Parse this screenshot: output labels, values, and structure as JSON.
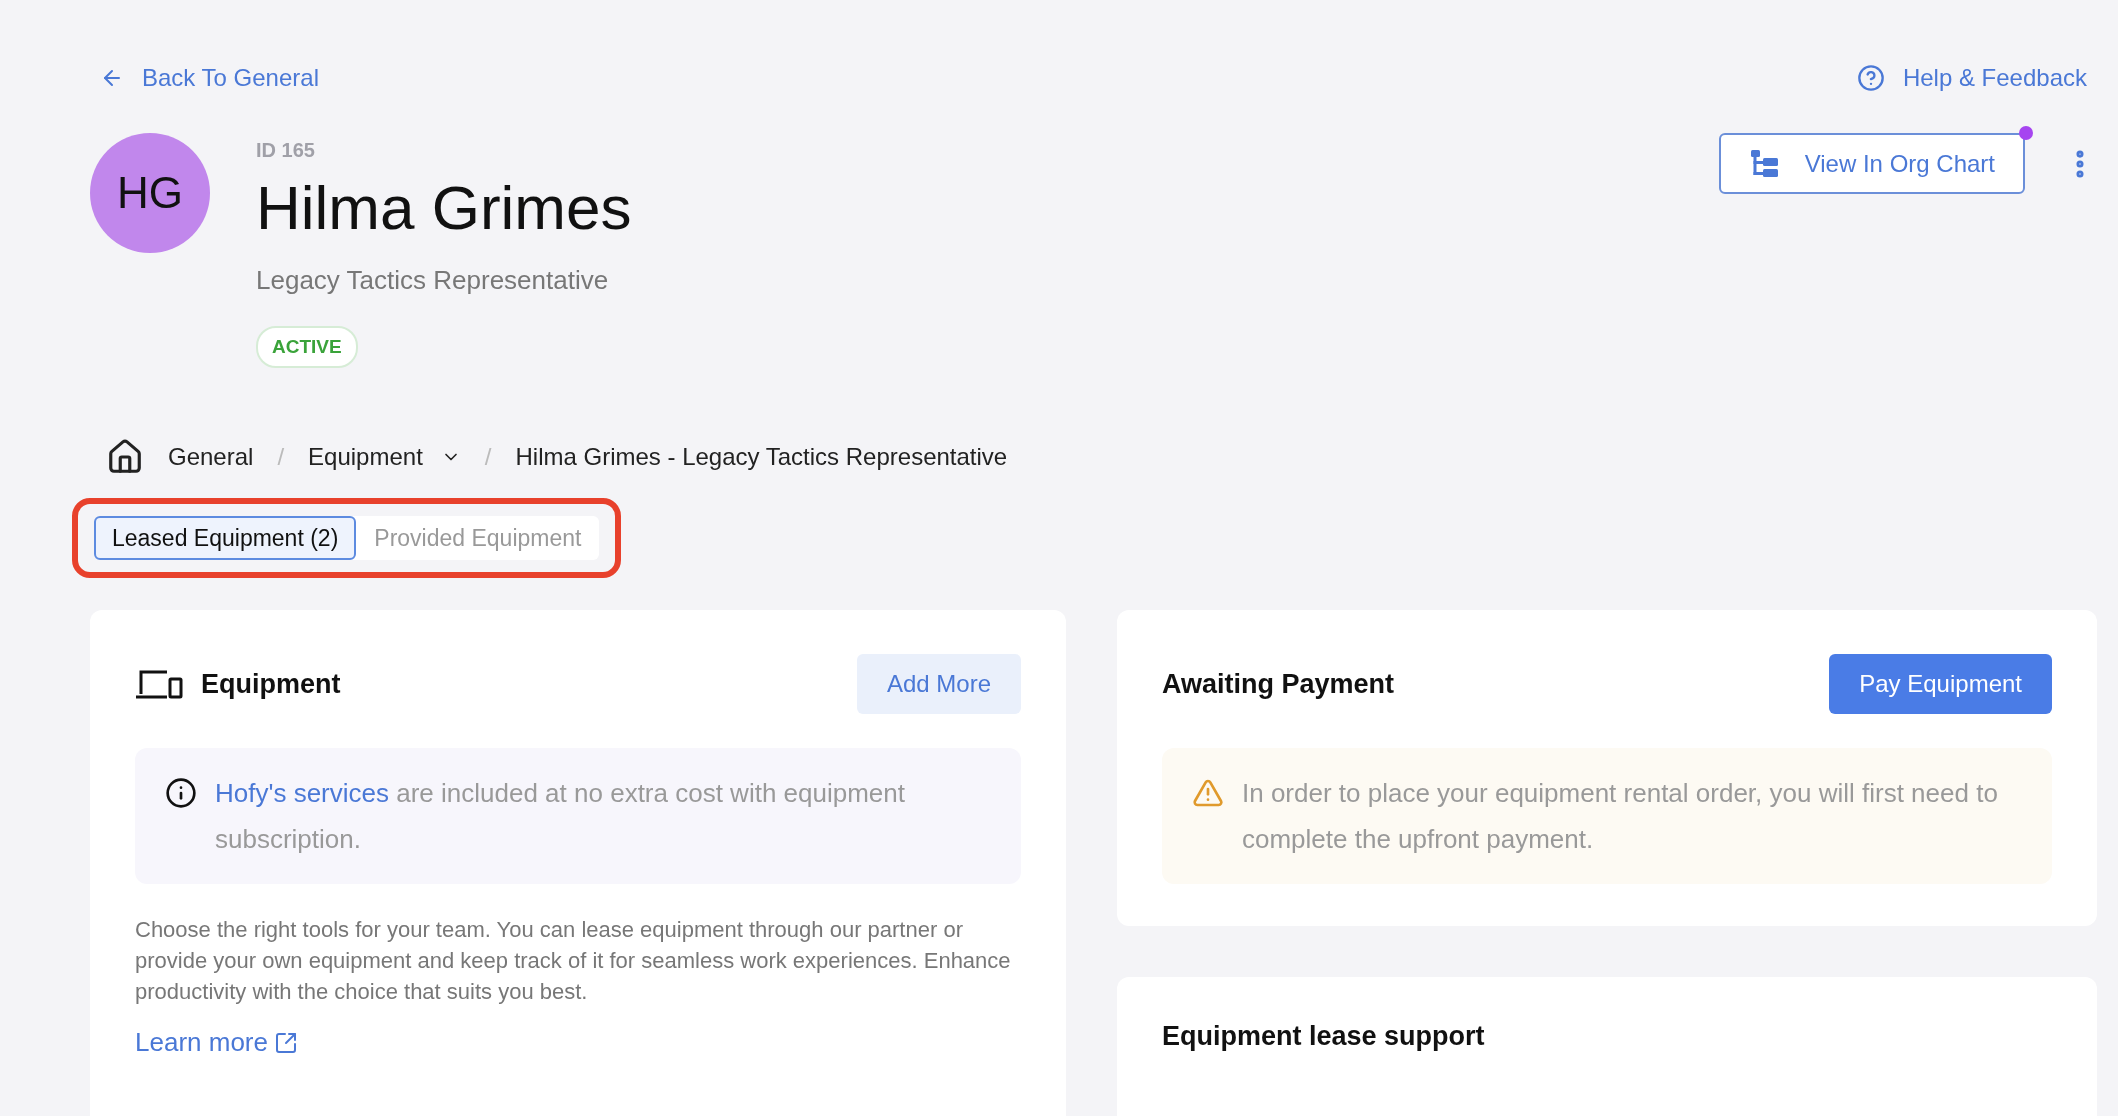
{
  "back_link": {
    "label": "Back To General"
  },
  "help_link": {
    "label": "Help & Feedback"
  },
  "profile": {
    "initials": "HG",
    "id": "ID 165",
    "name": "Hilma Grimes",
    "title": "Legacy Tactics Representative",
    "status": "ACTIVE"
  },
  "org_chart_button": {
    "label": "View In Org Chart",
    "notification": true
  },
  "breadcrumb": [
    {
      "kind": "home",
      "label": "General"
    },
    {
      "kind": "dropdown",
      "label": "Equipment",
      "separator": "/"
    },
    {
      "kind": "text",
      "label": "Hilma Grimes - Legacy Tactics Representative",
      "separator": "/"
    }
  ],
  "tabs": [
    {
      "label": "Leased Equipment (2)",
      "selected": true
    },
    {
      "label": "Provided Equipment",
      "selected": false
    }
  ],
  "equipment_card": {
    "title": "Equipment",
    "button": "Add More",
    "info_link": "Hofy's services",
    "info_text": " are included at no extra cost with equipment subscription.",
    "description": "Choose the right tools for your team. You can lease equipment through our partner or provide your own equipment and keep track of it for seamless work experiences. Enhance productivity with the choice that suits you best.",
    "learn_more": "Learn more"
  },
  "payment_card": {
    "title": "Awaiting Payment",
    "button": "Pay Equipment",
    "warning": "In order to place your equipment rental order, you will first need to complete the upfront payment."
  },
  "support_card": {
    "title": "Equipment lease support"
  }
}
